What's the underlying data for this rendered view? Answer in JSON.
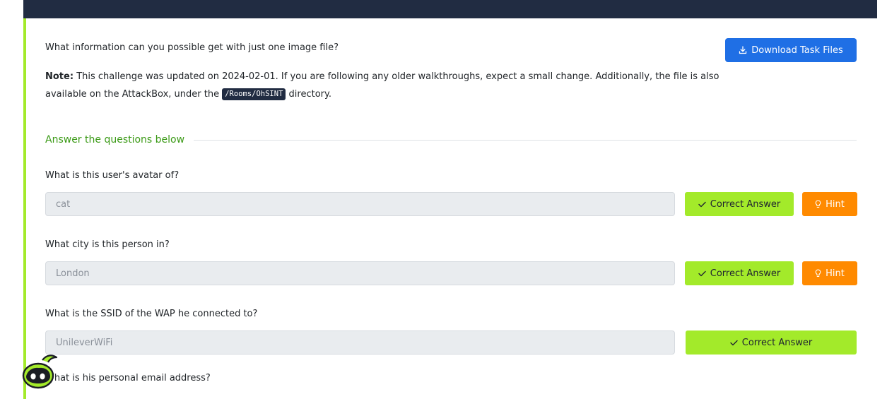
{
  "task": {
    "intro": "What information can you possible get with just one image file?",
    "download_label": "Download Task Files",
    "note_label": "Note:",
    "note_text_1": "This challenge was updated on 2024-02-01. If you are following any older walkthroughs, expect a small change. Additionally, the file is also available on the AttackBox, under the",
    "note_code": "/Rooms/OhSINT",
    "note_text_2": "directory."
  },
  "answers_section": {
    "title": "Answer the questions below",
    "questions": [
      {
        "question": "What is this user's avatar of?",
        "answer": "cat",
        "correct_label": "Correct Answer",
        "hint_label": "Hint"
      },
      {
        "question": "What city is this person in?",
        "answer": "London",
        "correct_label": "Correct Answer",
        "hint_label": "Hint"
      },
      {
        "question": "What is the SSID of the WAP he connected to?",
        "answer": "UnileverWiFi",
        "correct_label": "Correct Answer"
      },
      {
        "question": "What is his personal email address?"
      }
    ]
  },
  "colors": {
    "panel_accent": "#a3ea2a",
    "topbar": "#212c42",
    "download_button": "#1f6fe5",
    "correct_button": "#a3ea2a",
    "hint_button": "#ff8a00",
    "section_title": "#3b9a16"
  },
  "icons": {
    "download": "download-icon",
    "check": "check-icon",
    "hint": "lightbulb-icon",
    "mascot": "ghost-mascot-icon"
  }
}
